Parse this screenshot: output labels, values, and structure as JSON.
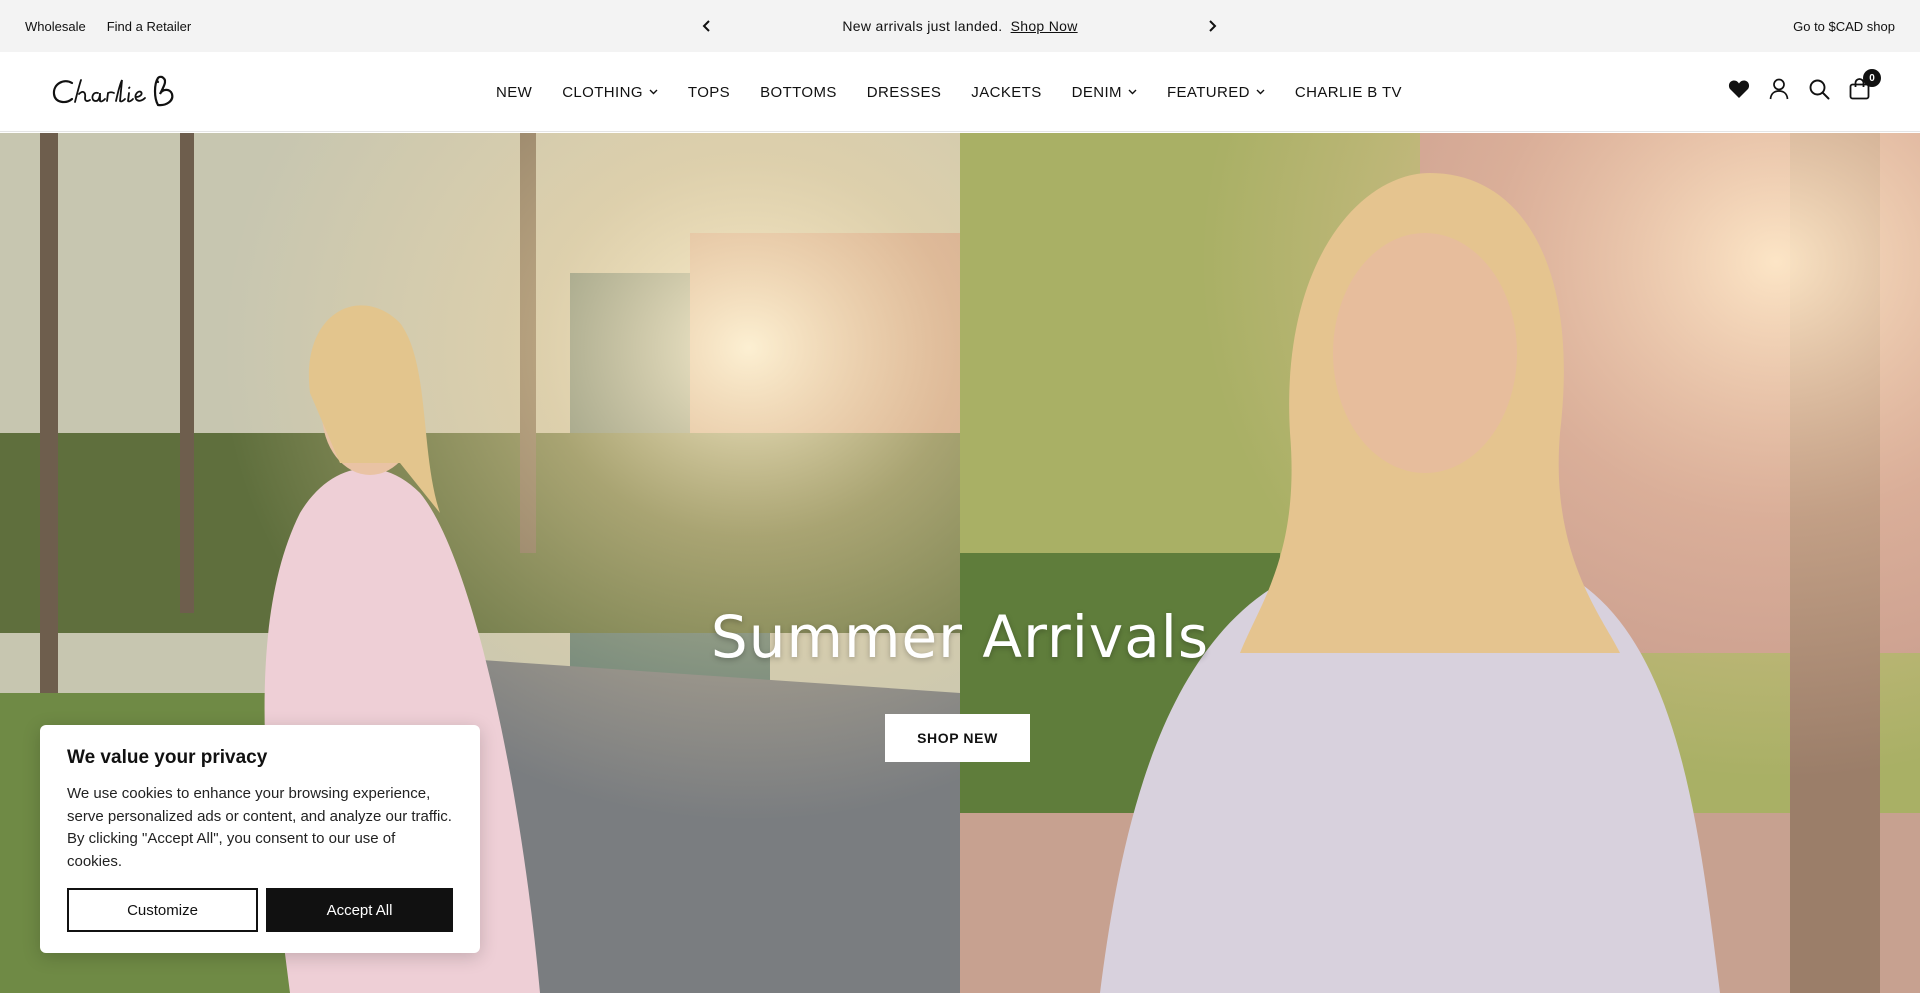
{
  "topbar": {
    "links": [
      "Wholesale",
      "Find a Retailer"
    ],
    "announcement": "New arrivals just landed.",
    "announcement_link": "Shop Now",
    "region_link": "Go to $CAD shop"
  },
  "header": {
    "logo_text": "Charlie B",
    "nav": [
      {
        "label": "NEW",
        "dropdown": false
      },
      {
        "label": "CLOTHING",
        "dropdown": true
      },
      {
        "label": "TOPS",
        "dropdown": false
      },
      {
        "label": "BOTTOMS",
        "dropdown": false
      },
      {
        "label": "DRESSES",
        "dropdown": false
      },
      {
        "label": "JACKETS",
        "dropdown": false
      },
      {
        "label": "DENIM",
        "dropdown": true
      },
      {
        "label": "FEATURED",
        "dropdown": true
      },
      {
        "label": "CHARLIE B TV",
        "dropdown": false
      }
    ],
    "icons": [
      "heart-icon",
      "account-icon",
      "search-icon",
      "cart-icon"
    ],
    "cart_count": "0"
  },
  "hero": {
    "title": "Summer Arrivals",
    "button": "SHOP NEW"
  },
  "cookie": {
    "title": "We value your privacy",
    "body": "We use cookies to enhance your browsing experience, serve personalized ads or content, and analyze our traffic. By clicking \"Accept All\", you consent to our use of cookies.",
    "customize": "Customize",
    "accept": "Accept All"
  }
}
